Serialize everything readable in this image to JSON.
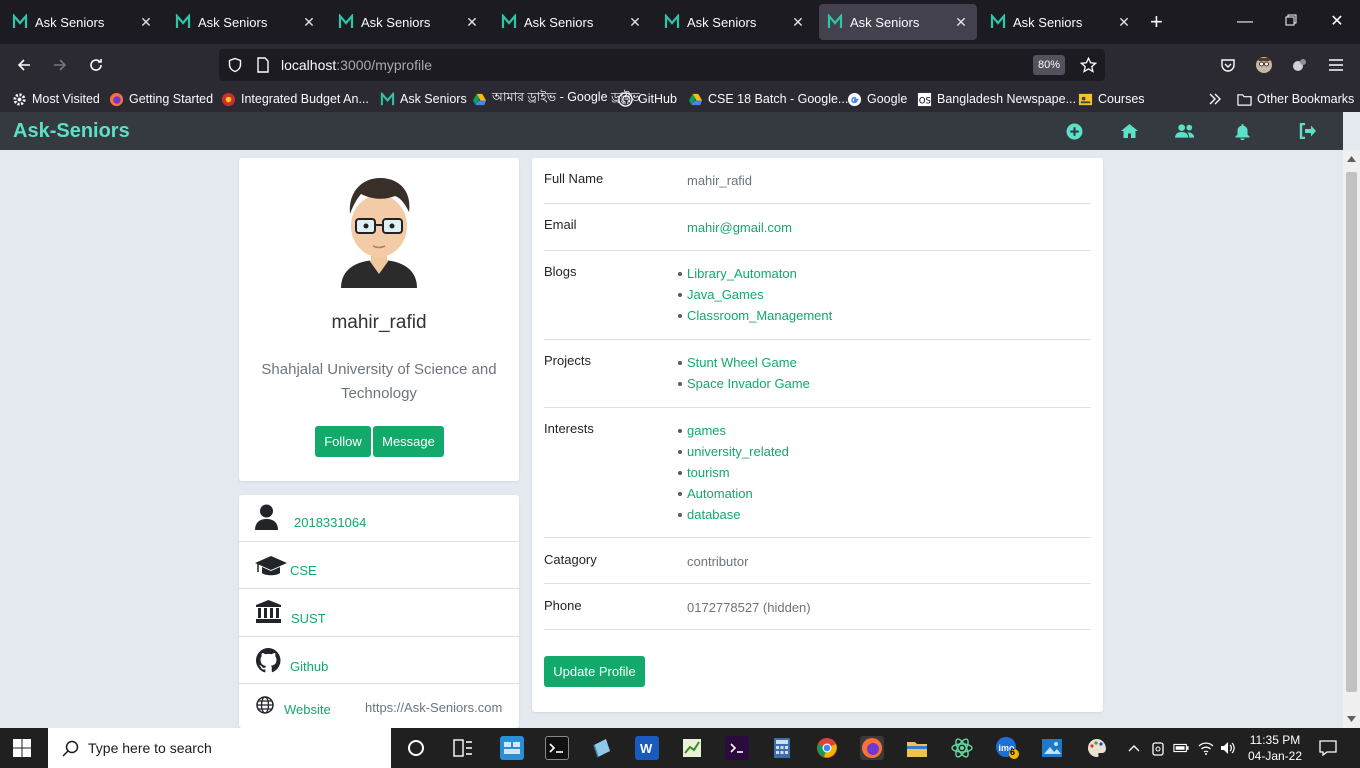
{
  "browser": {
    "tabs": [
      {
        "title": "Ask Seniors",
        "active": false
      },
      {
        "title": "Ask Seniors",
        "active": false
      },
      {
        "title": "Ask Seniors",
        "active": false
      },
      {
        "title": "Ask Seniors",
        "active": false
      },
      {
        "title": "Ask Seniors",
        "active": false
      },
      {
        "title": "Ask Seniors",
        "active": true
      },
      {
        "title": "Ask Seniors",
        "active": false
      }
    ],
    "url_host": "localhost",
    "url_path": ":3000/myprofile",
    "zoom": "80%",
    "bookmarks": [
      {
        "label": "Most Visited",
        "icon": "gear-icon"
      },
      {
        "label": "Getting Started",
        "icon": "firefox-icon"
      },
      {
        "label": "Integrated Budget An...",
        "icon": "budget-icon"
      },
      {
        "label": "Ask Seniors",
        "icon": "ask-seniors-icon"
      },
      {
        "label": "আমার ড্রাইভ - Google ড্রাইভ",
        "icon": "google-drive-icon"
      },
      {
        "label": "GitHub",
        "icon": "github-icon"
      },
      {
        "label": "CSE 18 Batch - Google...",
        "icon": "google-drive-icon"
      },
      {
        "label": "Google",
        "icon": "google-icon"
      },
      {
        "label": "Bangladesh Newspape...",
        "icon": "newspaper-icon"
      },
      {
        "label": "Courses",
        "icon": "courses-icon"
      }
    ],
    "other_bookmarks": "Other Bookmarks"
  },
  "app": {
    "brand": "Ask-Seniors",
    "accent": "#12a96b",
    "header_icons": [
      "plus-circle-icon",
      "home-icon",
      "users-icon",
      "bell-icon",
      "sign-out-icon"
    ]
  },
  "profile": {
    "username": "mahir_rafid",
    "university": "Shahjalal University of Science and Technology",
    "follow_label": "Follow",
    "message_label": "Message"
  },
  "info": {
    "reg_no": "2018331064",
    "department": "CSE",
    "institution": "SUST",
    "github": "Github",
    "website_label": "Website",
    "website_url": "https://Ask-Seniors.com"
  },
  "details": {
    "full_name_label": "Full Name",
    "full_name": "mahir_rafid",
    "email_label": "Email",
    "email": "mahir@gmail.com",
    "blogs_label": "Blogs",
    "blogs": [
      "Library_Automaton",
      "Java_Games",
      "Classroom_Management"
    ],
    "projects_label": "Projects",
    "projects": [
      "Stunt Wheel Game",
      "Space Invador Game"
    ],
    "interests_label": "Interests",
    "interests": [
      "games",
      "university_related",
      "tourism",
      "Automation",
      "database"
    ],
    "category_label": "Catagory",
    "category": "contributor",
    "phone_label": "Phone",
    "phone": "0172778527 (hidden)",
    "update_label": "Update Profile"
  },
  "taskbar": {
    "search_placeholder": "Type here to search",
    "time": "11:35 PM",
    "date": "04-Jan-22",
    "imo_badge": "6"
  }
}
